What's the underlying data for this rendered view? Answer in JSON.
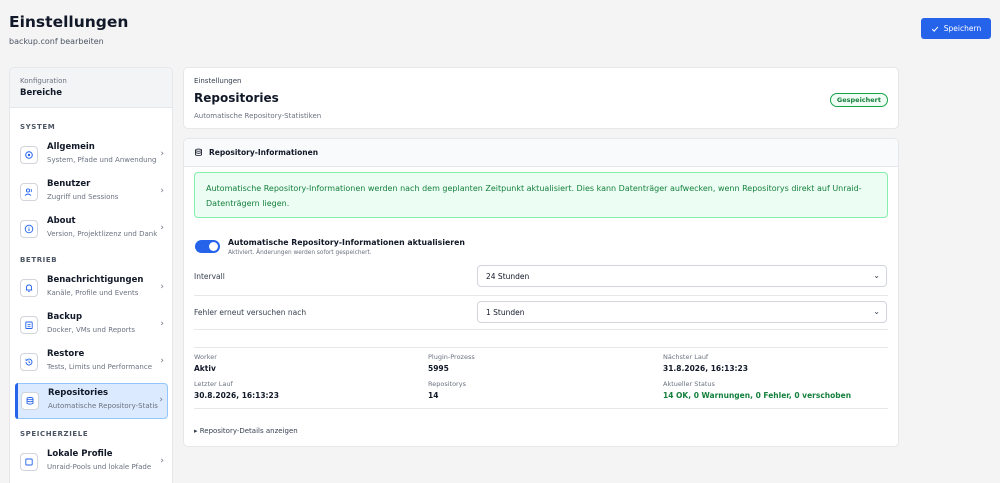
{
  "header": {
    "title": "Einstellungen",
    "subtitle": "backup.conf bearbeiten",
    "save_label": "Speichern"
  },
  "sidebar": {
    "head_small": "Konfiguration",
    "head_big": "Bereiche",
    "sections": [
      "SYSTEM",
      "BETRIEB",
      "SPEICHERZIELE"
    ],
    "items": [
      {
        "label": "Allgemein",
        "desc": "System, Pfade und Anwendungen",
        "icon": "gear-icon"
      },
      {
        "label": "Benutzer",
        "desc": "Zugriff und Sessions",
        "icon": "users-icon"
      },
      {
        "label": "About",
        "desc": "Version, Projektlizenz und Danksagungen",
        "icon": "info-icon"
      },
      {
        "label": "Benachrichtigungen",
        "desc": "Kanäle, Profile und Events",
        "icon": "bell-icon"
      },
      {
        "label": "Backup",
        "desc": "Docker, VMs und Reports",
        "icon": "archive-icon"
      },
      {
        "label": "Restore",
        "desc": "Tests, Limits und Performance",
        "icon": "history-icon"
      },
      {
        "label": "Repositories",
        "desc": "Automatische Repository-Statistiken",
        "icon": "database-icon"
      },
      {
        "label": "Lokale Profile",
        "desc": "Unraid-Pools und lokale Pfade",
        "icon": "square-icon"
      }
    ]
  },
  "page": {
    "small": "Einstellungen",
    "title": "Repositories",
    "subtitle": "Automatische Repository-Statistiken",
    "badge": "Gespeichert"
  },
  "panel": {
    "title": "Repository-Informationen",
    "alert": "Automatische Repository-Informationen werden nach dem geplanten Zeitpunkt aktualisiert. Dies kann Datenträger aufwecken, wenn Repositorys direkt auf Unraid-Datenträgern liegen.",
    "toggle_label": "Automatische Repository-Informationen aktualisieren",
    "toggle_hint": "Aktiviert. Änderungen werden sofort gespeichert.",
    "toggle_on": true,
    "interval_label": "Intervall",
    "interval_value": "24 Stunden",
    "retry_label": "Fehler erneut versuchen nach",
    "retry_value": "1 Stunden",
    "stats": {
      "worker_label": "Worker",
      "worker_value": "Aktiv",
      "plugin_label": "Plugin-Prozess",
      "plugin_value": "5995",
      "next_label": "Nächster Lauf",
      "next_value": "31.8.2026, 16:13:23",
      "last_label": "Letzter Lauf",
      "last_value": "30.8.2026, 16:13:23",
      "repos_label": "Repositorys",
      "repos_value": "14",
      "status_label": "Aktueller Status",
      "status_value": "14 OK, 0 Warnungen, 0 Fehler, 0 verschoben"
    },
    "details_link": "▸ Repository-Details anzeigen"
  },
  "colors": {
    "accent": "#2563eb",
    "success": "#15803d",
    "success_bg": "#ecfdf3"
  }
}
